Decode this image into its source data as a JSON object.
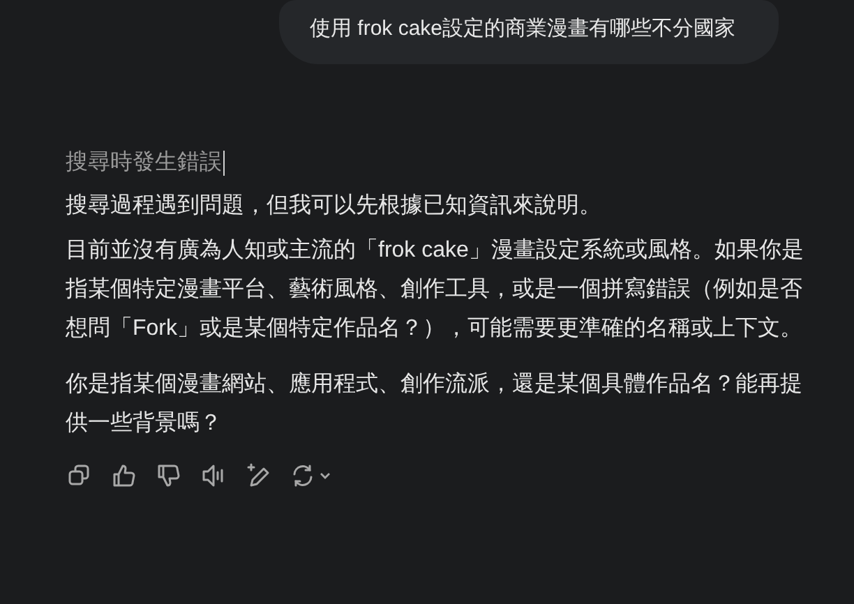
{
  "user_message": "使用 frok cake設定的商業漫畫有哪些不分國家",
  "response": {
    "status": "搜尋時發生錯誤",
    "status_cursor": true,
    "paragraphs": [
      "搜尋過程遇到問題，但我可以先根據已知資訊來說明。",
      "目前並沒有廣為人知或主流的「frok cake」漫畫設定系統或風格。如果你是指某個特定漫畫平台、藝術風格、創作工具，或是一個拼寫錯誤（例如是否想問「Fork」或是某個特定作品名？），可能需要更準確的名稱或上下文。",
      "你是指某個漫畫網站、應用程式、創作流派，還是某個具體作品名？能再提供一些背景嗎？"
    ]
  }
}
